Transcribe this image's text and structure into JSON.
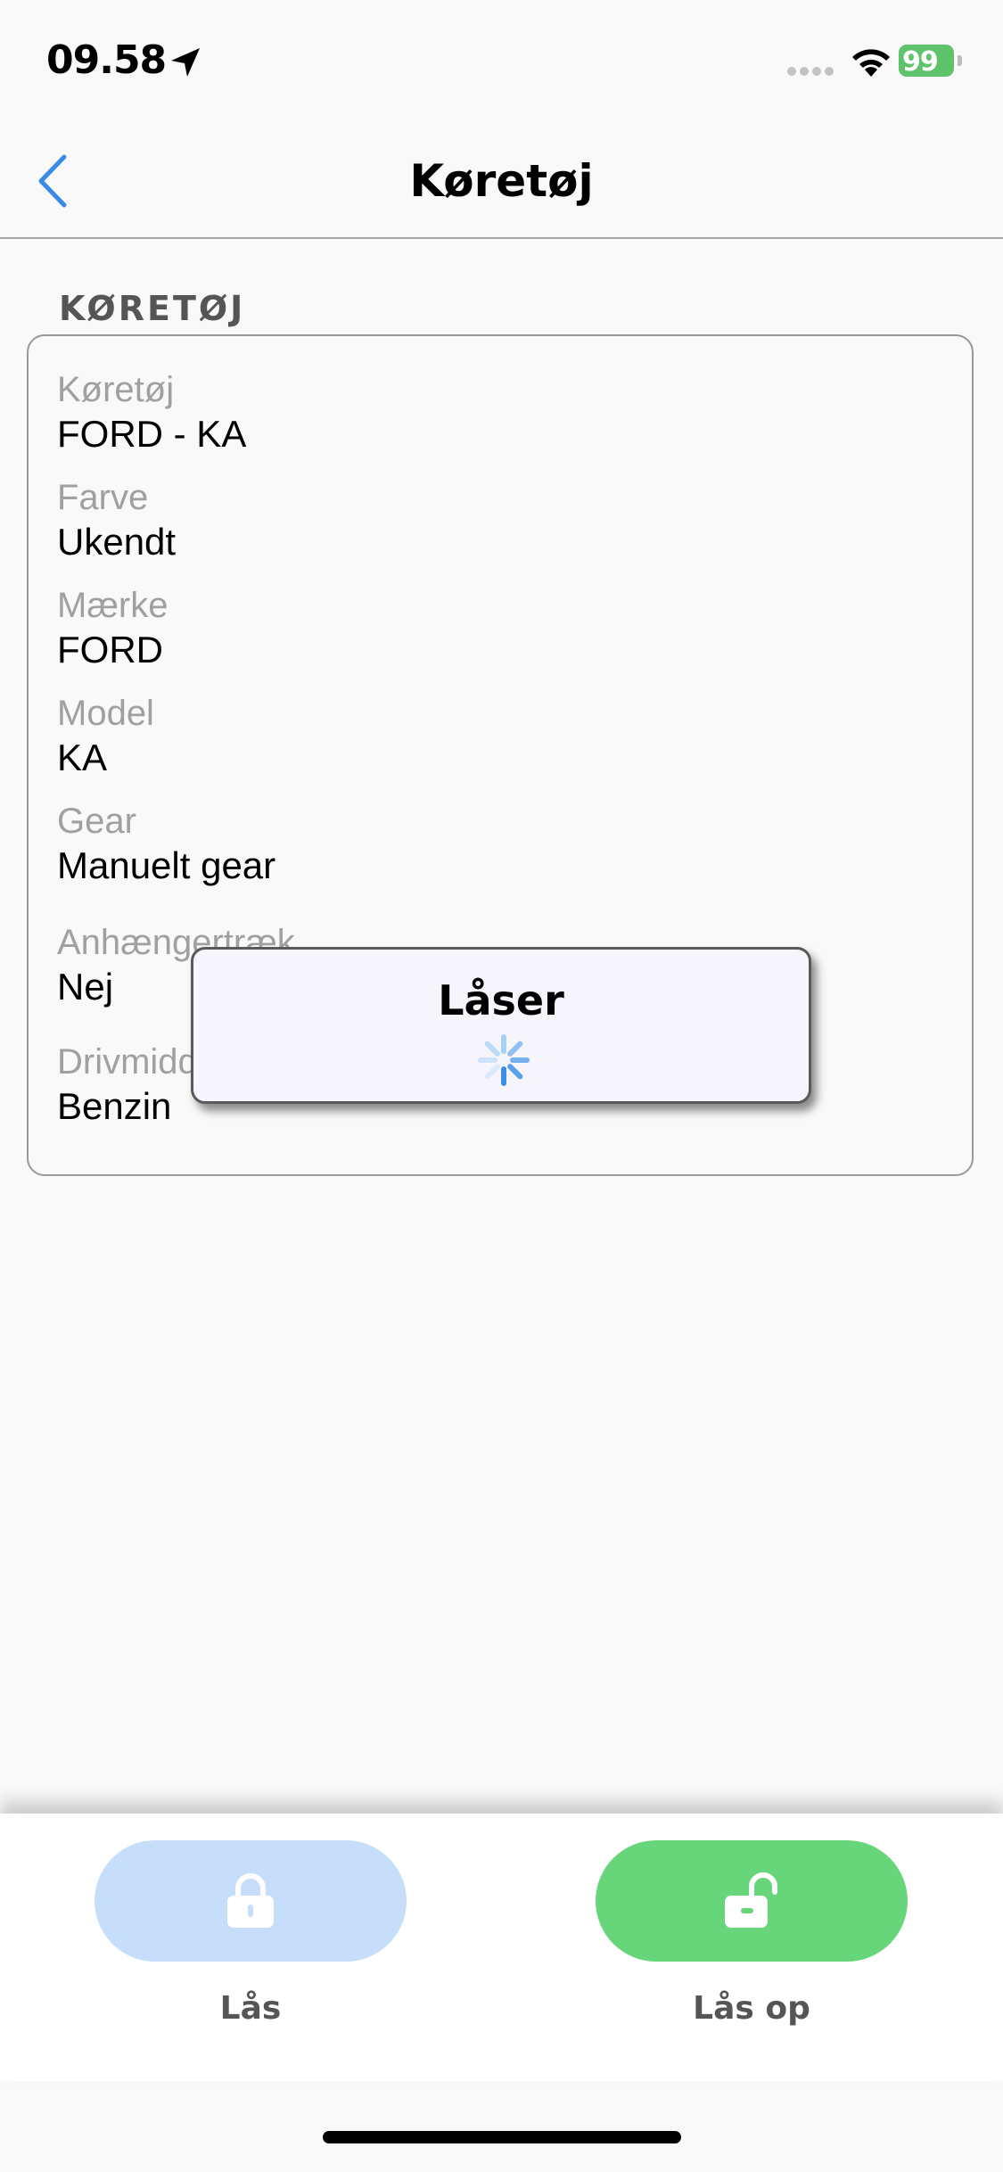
{
  "status_bar": {
    "time": "09.58",
    "battery_level": "99"
  },
  "nav": {
    "title": "Køretøj",
    "back_icon": "chevron-left-icon",
    "accent_color": "#3a8be8"
  },
  "section": {
    "header": "KØRETØJ",
    "fields": [
      {
        "label": "Køretøj",
        "value": "FORD - KA"
      },
      {
        "label": "Farve",
        "value": "Ukendt"
      },
      {
        "label": "Mærke",
        "value": "FORD"
      },
      {
        "label": "Model",
        "value": "KA"
      },
      {
        "label": "Gear",
        "value": "Manuelt gear"
      },
      {
        "label": "Anhængertræk",
        "value": "Nej"
      },
      {
        "label": "Drivmiddel",
        "value": "Benzin"
      }
    ]
  },
  "toast": {
    "title": "Låser",
    "spinner_icon": "activity-spinner-icon"
  },
  "actions": {
    "lock": {
      "label": "Lås",
      "icon": "lock-icon",
      "color": "#c6defa"
    },
    "unlock": {
      "label": "Lås op",
      "icon": "unlock-icon",
      "color": "#67d67a"
    }
  }
}
